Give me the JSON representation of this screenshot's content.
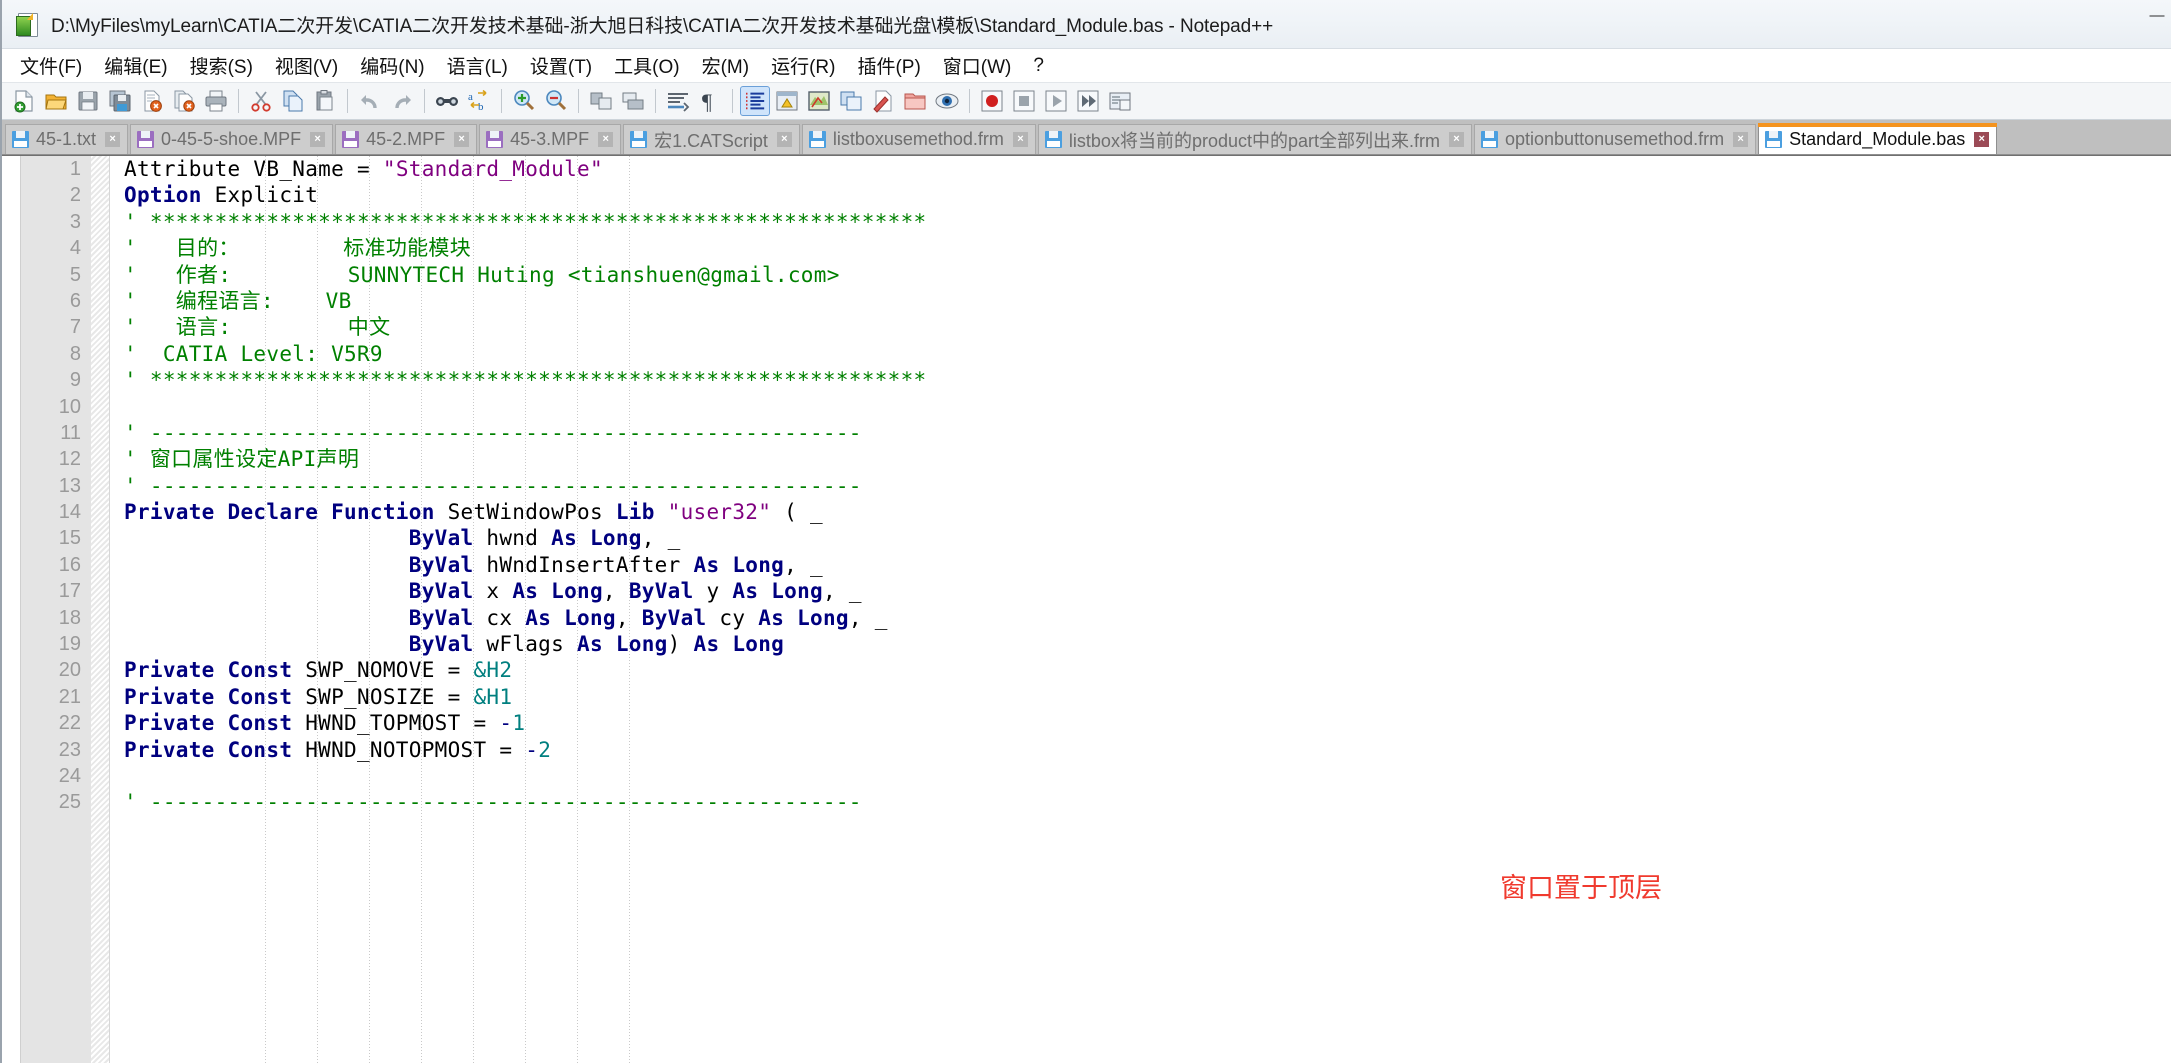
{
  "window": {
    "title": "D:\\MyFiles\\myLearn\\CATIA二次开发\\CATIA二次开发技术基础-浙大旭日科技\\CATIA二次开发技术基础光盘\\模板\\Standard_Module.bas - Notepad++",
    "icon": "notepad-plus-plus-icon",
    "minimize": "—",
    "maximize": "▢",
    "close": "✕"
  },
  "menu": {
    "items": [
      {
        "label": "文件(F)",
        "name": "menu-file"
      },
      {
        "label": "编辑(E)",
        "name": "menu-edit"
      },
      {
        "label": "搜索(S)",
        "name": "menu-search"
      },
      {
        "label": "视图(V)",
        "name": "menu-view"
      },
      {
        "label": "编码(N)",
        "name": "menu-encoding"
      },
      {
        "label": "语言(L)",
        "name": "menu-language"
      },
      {
        "label": "设置(T)",
        "name": "menu-settings"
      },
      {
        "label": "工具(O)",
        "name": "menu-tools"
      },
      {
        "label": "宏(M)",
        "name": "menu-macro"
      },
      {
        "label": "运行(R)",
        "name": "menu-run"
      },
      {
        "label": "插件(P)",
        "name": "menu-plugins"
      },
      {
        "label": "窗口(W)",
        "name": "menu-window"
      },
      {
        "label": "?",
        "name": "menu-help"
      }
    ]
  },
  "toolbar": {
    "buttons": [
      {
        "name": "new-file-icon",
        "group": 0
      },
      {
        "name": "open-file-icon",
        "group": 0
      },
      {
        "name": "save-icon",
        "group": 0
      },
      {
        "name": "save-all-icon",
        "group": 0
      },
      {
        "name": "close-file-icon",
        "group": 0
      },
      {
        "name": "close-all-icon",
        "group": 0
      },
      {
        "name": "print-icon",
        "group": 0
      },
      {
        "name": "cut-icon",
        "group": 1
      },
      {
        "name": "copy-icon",
        "group": 1
      },
      {
        "name": "paste-icon",
        "group": 1
      },
      {
        "name": "undo-icon",
        "group": 2
      },
      {
        "name": "redo-icon",
        "group": 2
      },
      {
        "name": "find-icon",
        "group": 3
      },
      {
        "name": "replace-icon",
        "group": 3
      },
      {
        "name": "zoom-in-icon",
        "group": 4
      },
      {
        "name": "zoom-out-icon",
        "group": 4
      },
      {
        "name": "sync-vertical-scroll-icon",
        "group": 5
      },
      {
        "name": "sync-horizontal-scroll-icon",
        "group": 5
      },
      {
        "name": "word-wrap-icon",
        "group": 6
      },
      {
        "name": "show-all-characters-icon",
        "group": 6
      },
      {
        "name": "indent-guideline-icon",
        "group": 7,
        "selected": true
      },
      {
        "name": "user-defined-language-icon",
        "group": 7
      },
      {
        "name": "document-map-icon",
        "group": 7
      },
      {
        "name": "function-list-icon",
        "group": 7
      },
      {
        "name": "folder-as-workspace-icon",
        "group": 7
      },
      {
        "name": "monitoring-icon",
        "group": 7
      },
      {
        "name": "record-macro-icon",
        "group": 8
      },
      {
        "name": "stop-recording-icon",
        "group": 8
      },
      {
        "name": "playback-macro-icon",
        "group": 8
      },
      {
        "name": "run-macro-multiple-icon",
        "group": 8
      },
      {
        "name": "run-icon",
        "group": 8
      }
    ]
  },
  "tabs": [
    {
      "label": "45-1.txt",
      "active": false,
      "color": "#4b9fe0",
      "name": "tab-45-1-txt"
    },
    {
      "label": "0-45-5-shoe.MPF",
      "active": false,
      "color": "#9b6ec0",
      "name": "tab-0-45-5-shoe-mpf"
    },
    {
      "label": "45-2.MPF",
      "active": false,
      "color": "#9b6ec0",
      "name": "tab-45-2-mpf"
    },
    {
      "label": "45-3.MPF",
      "active": false,
      "color": "#9b6ec0",
      "name": "tab-45-3-mpf"
    },
    {
      "label": "宏1.CATScript",
      "active": false,
      "color": "#4b9fe0",
      "name": "tab-macro1-catscript"
    },
    {
      "label": "listboxusemethod.frm",
      "active": false,
      "color": "#4b9fe0",
      "name": "tab-listboxusemethod-frm"
    },
    {
      "label": "listbox将当前的product中的part全部列出来.frm",
      "active": false,
      "color": "#4b9fe0",
      "name": "tab-listbox-product-part-frm"
    },
    {
      "label": "optionbuttonusemethod.frm",
      "active": false,
      "color": "#4b9fe0",
      "name": "tab-optionbuttonusemethod-frm"
    },
    {
      "label": "Standard_Module.bas",
      "active": true,
      "color": "#4b9fe0",
      "name": "tab-standard-module-bas"
    }
  ],
  "editor": {
    "line_numbers": [
      1,
      2,
      3,
      4,
      5,
      6,
      7,
      8,
      9,
      10,
      11,
      12,
      13,
      14,
      15,
      16,
      17,
      18,
      19,
      20,
      21,
      22,
      23,
      24,
      25
    ],
    "lines": [
      {
        "n": 1,
        "tokens": [
          {
            "t": "Attribute VB_Name = ",
            "c": "id"
          },
          {
            "t": "\"Standard_Module\"",
            "c": "str"
          }
        ]
      },
      {
        "n": 2,
        "tokens": [
          {
            "t": "Option",
            "c": "kw"
          },
          {
            "t": " Explicit",
            "c": "id"
          }
        ]
      },
      {
        "n": 3,
        "tokens": [
          {
            "t": "' ************************************************************",
            "c": "cm"
          }
        ]
      },
      {
        "n": 4,
        "tokens": [
          {
            "t": "'   目的：        标准功能模块",
            "c": "cm"
          }
        ]
      },
      {
        "n": 5,
        "tokens": [
          {
            "t": "'   作者:         SUNNYTECH Huting <tianshuen@gmail.com>",
            "c": "cm"
          }
        ]
      },
      {
        "n": 6,
        "tokens": [
          {
            "t": "'   编程语言:    VB",
            "c": "cm"
          }
        ]
      },
      {
        "n": 7,
        "tokens": [
          {
            "t": "'   语言:         中文",
            "c": "cm"
          }
        ]
      },
      {
        "n": 8,
        "tokens": [
          {
            "t": "'  CATIA Level: V5R9",
            "c": "cm"
          }
        ]
      },
      {
        "n": 9,
        "tokens": [
          {
            "t": "' ************************************************************",
            "c": "cm"
          }
        ]
      },
      {
        "n": 10,
        "tokens": []
      },
      {
        "n": 11,
        "tokens": [
          {
            "t": "' -------------------------------------------------------",
            "c": "cm"
          }
        ]
      },
      {
        "n": 12,
        "tokens": [
          {
            "t": "' 窗口属性设定API声明",
            "c": "cm"
          }
        ]
      },
      {
        "n": 13,
        "tokens": [
          {
            "t": "' -------------------------------------------------------",
            "c": "cm"
          }
        ]
      },
      {
        "n": 14,
        "tokens": [
          {
            "t": "Private Declare Function",
            "c": "kw"
          },
          {
            "t": " SetWindowPos ",
            "c": "id"
          },
          {
            "t": "Lib",
            "c": "kw"
          },
          {
            "t": " ",
            "c": "id"
          },
          {
            "t": "\"user32\"",
            "c": "str"
          },
          {
            "t": " ( _",
            "c": "id"
          }
        ]
      },
      {
        "n": 15,
        "tokens": [
          {
            "t": "                      ",
            "c": "id"
          },
          {
            "t": "ByVal",
            "c": "kw"
          },
          {
            "t": " hwnd ",
            "c": "id"
          },
          {
            "t": "As Long",
            "c": "kw"
          },
          {
            "t": ", _",
            "c": "id"
          }
        ]
      },
      {
        "n": 16,
        "tokens": [
          {
            "t": "                      ",
            "c": "id"
          },
          {
            "t": "ByVal",
            "c": "kw"
          },
          {
            "t": " hWndInsertAfter ",
            "c": "id"
          },
          {
            "t": "As Long",
            "c": "kw"
          },
          {
            "t": ", _",
            "c": "id"
          }
        ]
      },
      {
        "n": 17,
        "tokens": [
          {
            "t": "                      ",
            "c": "id"
          },
          {
            "t": "ByVal",
            "c": "kw"
          },
          {
            "t": " x ",
            "c": "id"
          },
          {
            "t": "As Long",
            "c": "kw"
          },
          {
            "t": ", ",
            "c": "id"
          },
          {
            "t": "ByVal",
            "c": "kw"
          },
          {
            "t": " y ",
            "c": "id"
          },
          {
            "t": "As Long",
            "c": "kw"
          },
          {
            "t": ", _",
            "c": "id"
          }
        ]
      },
      {
        "n": 18,
        "tokens": [
          {
            "t": "                      ",
            "c": "id"
          },
          {
            "t": "ByVal",
            "c": "kw"
          },
          {
            "t": " cx ",
            "c": "id"
          },
          {
            "t": "As Long",
            "c": "kw"
          },
          {
            "t": ", ",
            "c": "id"
          },
          {
            "t": "ByVal",
            "c": "kw"
          },
          {
            "t": " cy ",
            "c": "id"
          },
          {
            "t": "As Long",
            "c": "kw"
          },
          {
            "t": ", _",
            "c": "id"
          }
        ]
      },
      {
        "n": 19,
        "tokens": [
          {
            "t": "                      ",
            "c": "id"
          },
          {
            "t": "ByVal",
            "c": "kw"
          },
          {
            "t": " wFlags ",
            "c": "id"
          },
          {
            "t": "As Long",
            "c": "kw"
          },
          {
            "t": ") ",
            "c": "id"
          },
          {
            "t": "As Long",
            "c": "kw"
          }
        ]
      },
      {
        "n": 20,
        "tokens": [
          {
            "t": "Private Const",
            "c": "kw"
          },
          {
            "t": " SWP_NOMOVE = ",
            "c": "id"
          },
          {
            "t": "&H2",
            "c": "num"
          }
        ]
      },
      {
        "n": 21,
        "tokens": [
          {
            "t": "Private Const",
            "c": "kw"
          },
          {
            "t": " SWP_NOSIZE = ",
            "c": "id"
          },
          {
            "t": "&H1",
            "c": "num"
          }
        ]
      },
      {
        "n": 22,
        "tokens": [
          {
            "t": "Private Const",
            "c": "kw"
          },
          {
            "t": " HWND_TOPMOST = ",
            "c": "id"
          },
          {
            "t": "-",
            "c": "op"
          },
          {
            "t": "1",
            "c": "num"
          }
        ]
      },
      {
        "n": 23,
        "tokens": [
          {
            "t": "Private Const",
            "c": "kw"
          },
          {
            "t": " HWND_NOTOPMOST = ",
            "c": "id"
          },
          {
            "t": "-",
            "c": "op"
          },
          {
            "t": "2",
            "c": "num"
          }
        ]
      },
      {
        "n": 24,
        "tokens": []
      },
      {
        "n": 25,
        "tokens": [
          {
            "t": "' -------------------------------------------------------",
            "c": "cm"
          }
        ]
      }
    ],
    "annotation": {
      "text": "窗口置于顶层",
      "color": "#f03a2e",
      "line": 17
    }
  },
  "colors": {
    "keyword": "#00007f",
    "string": "#7f007f",
    "comment": "#008000",
    "number": "#007f7f",
    "active_tab_accent": "#f4931e",
    "tabbar_background": "#bfbfbf",
    "linenumber_background": "#e4e4e4"
  }
}
